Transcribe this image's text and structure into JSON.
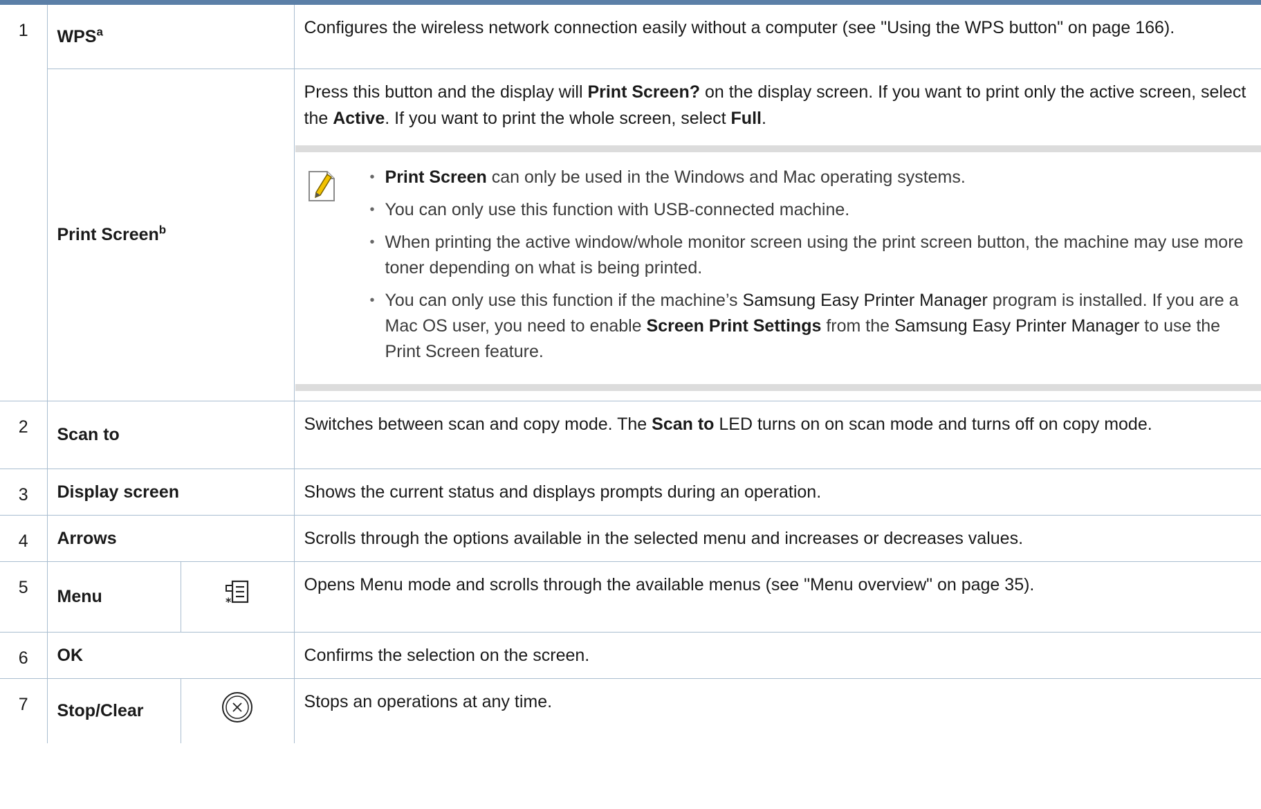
{
  "rows": [
    {
      "num": "1",
      "name": "WPS",
      "sup": "a",
      "desc": "Configures the wireless network connection easily without a computer (see \"Using the WPS button\" on page 166)."
    },
    {
      "name": "Print Screen",
      "sup": "b",
      "desc": [
        {
          "t": "Press this button and the display will "
        },
        {
          "b": "Print Screen?"
        },
        {
          "t": " on the display screen. If you want to print only the active screen, select the "
        },
        {
          "b": "Active"
        },
        {
          "t": ". If you want to print the whole screen, select "
        },
        {
          "b": "Full"
        },
        {
          "t": "."
        }
      ],
      "note": {
        "icon": "note-pencil-icon",
        "items": [
          [
            {
              "b": "Print Screen"
            },
            {
              "t": " can only be used in the Windows and Mac operating systems."
            }
          ],
          [
            {
              "t": "You can only use this function with USB-connected machine."
            }
          ],
          [
            {
              "t": "When printing the active window/whole monitor screen using the print screen button, the machine may use more toner depending on what is being printed."
            }
          ],
          [
            {
              "t": "You can only use this function if the machine’s "
            },
            {
              "e": "Samsung Easy Printer Manager"
            },
            {
              "t": " program is installed. If you are a Mac OS user, you need to enable "
            },
            {
              "b": "Screen Print Settings"
            },
            {
              "t": " from the "
            },
            {
              "e": "Samsung Easy Printer Manager"
            },
            {
              "t": " to use the Print Screen feature."
            }
          ]
        ]
      }
    },
    {
      "num": "2",
      "name": "Scan to",
      "desc": [
        {
          "t": "Switches between scan and copy mode. The "
        },
        {
          "b": "Scan to"
        },
        {
          "t": " LED turns on on scan mode and turns off on copy mode."
        }
      ]
    },
    {
      "num": "3",
      "name": "Display screen",
      "desc": "Shows the current status and displays prompts during an operation."
    },
    {
      "num": "4",
      "name": "Arrows",
      "desc": "Scrolls through the options available in the selected menu and increases or decreases values."
    },
    {
      "num": "5",
      "name": "Menu",
      "icon": "menu-icon",
      "desc": "Opens Menu mode and scrolls through the available menus (see \"Menu overview\" on page 35)."
    },
    {
      "num": "6",
      "name": "OK",
      "desc": "Confirms the selection on the screen."
    },
    {
      "num": "7",
      "name": "Stop/Clear",
      "icon": "stop-clear-icon",
      "desc": "Stops an operations at any time."
    }
  ],
  "colors": {
    "rule": "#a9bdd0",
    "topbar": "#5b7fa7",
    "note_band": "#dcdcdc"
  }
}
